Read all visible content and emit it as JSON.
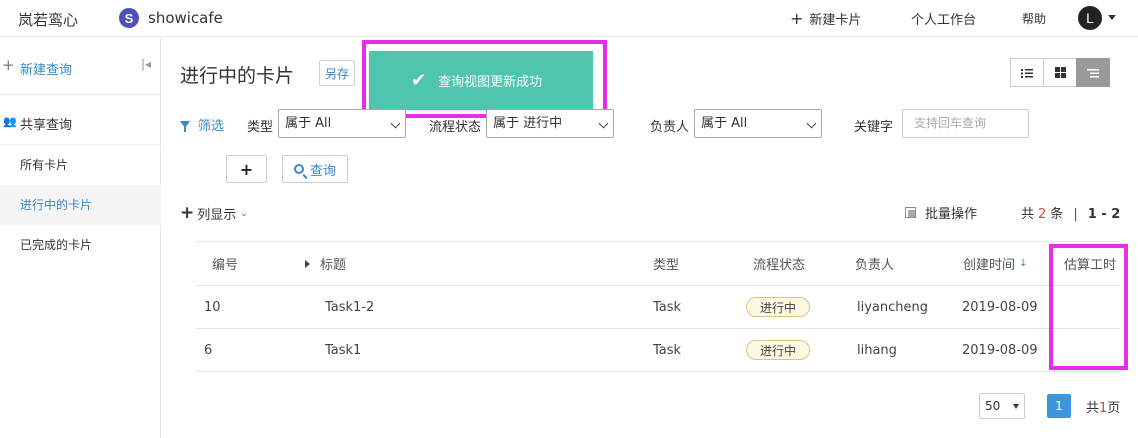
{
  "topbar": {
    "brand": "岚若鸾心",
    "project_logo_letter": "S",
    "project_name": "showicafe",
    "new_card": "新建卡片",
    "workbench": "个人工作台",
    "help": "帮助",
    "avatar_letter": "L"
  },
  "sidebar": {
    "new_query": "新建查询",
    "shared_query": "共享查询",
    "items": [
      {
        "label": "所有卡片",
        "active": false
      },
      {
        "label": "进行中的卡片",
        "active": true
      },
      {
        "label": "已完成的卡片",
        "active": false
      }
    ]
  },
  "main": {
    "title": "进行中的卡片",
    "save_as": "另存",
    "toast": "查询视图更新成功"
  },
  "filters": {
    "filter_link": "筛选",
    "type_label": "类型",
    "type_value": "属于 All",
    "status_label": "流程状态",
    "status_value": "属于 进行中",
    "owner_label": "负责人",
    "owner_value": "属于 All",
    "keyword_label": "关键字",
    "keyword_placeholder": "支持回车查询",
    "query_button": "查询"
  },
  "toolbar": {
    "column_display": "列显示",
    "batch_ops": "批量操作",
    "count_prefix": "共",
    "count_value": "2",
    "count_suffix": "条",
    "range": "1 - 2"
  },
  "table": {
    "headers": {
      "id": "编号",
      "title": "标题",
      "type": "类型",
      "status": "流程状态",
      "owner": "负责人",
      "created": "创建时间",
      "estimate": "估算工时"
    },
    "rows": [
      {
        "id": "10",
        "title": "Task1-2",
        "type": "Task",
        "status": "进行中",
        "owner": "liyancheng",
        "created": "2019-08-09",
        "estimate": ""
      },
      {
        "id": "6",
        "title": "Task1",
        "type": "Task",
        "status": "进行中",
        "owner": "lihang",
        "created": "2019-08-09",
        "estimate": ""
      }
    ]
  },
  "pager": {
    "page_size": "50",
    "current_page": "1",
    "total_prefix": "共",
    "total_pages": "1",
    "total_suffix": "页"
  },
  "colors": {
    "accent": "#3a87c8",
    "toast_bg": "#4fc5ad",
    "highlight": "#e62ee6",
    "badge_bg": "#fdf8e2"
  }
}
